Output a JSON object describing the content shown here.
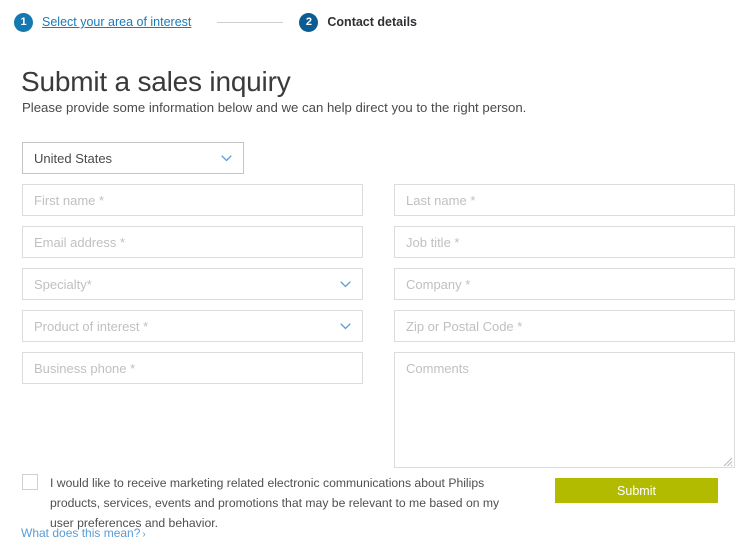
{
  "stepper": {
    "steps": [
      {
        "number": "1",
        "label": "Select your area of interest"
      },
      {
        "number": "2",
        "label": "Contact details"
      }
    ]
  },
  "header": {
    "title": "Submit a sales inquiry",
    "subtitle": "Please provide some information below and we can help direct you to the right person."
  },
  "form": {
    "country": {
      "value": "United States"
    },
    "fields": {
      "first_name": "First name *",
      "last_name": "Last name *",
      "email": "Email address  *",
      "job_title": "Job title *",
      "specialty": "Specialty*",
      "company": "Company *",
      "product_of_interest": "Product of interest *",
      "zip": "Zip or Postal Code *",
      "business_phone": "Business phone *",
      "comments": "Comments"
    }
  },
  "consent": {
    "text": "I would like to receive marketing related electronic communications about Philips products, services, events and promotions that may be relevant to me based on my user preferences and behavior.",
    "link_label": "What does this mean?",
    "link_arrow": "›"
  },
  "actions": {
    "submit_label": "Submit"
  },
  "colors": {
    "step_active": "#1479b0",
    "step_current": "#0b5c92",
    "link_blue": "#1a7bb9",
    "light_blue": "#5b9bd5",
    "submit_olive": "#b3bb00",
    "border_gray": "#dcdcdc",
    "placeholder_gray": "#c0c0c0"
  }
}
